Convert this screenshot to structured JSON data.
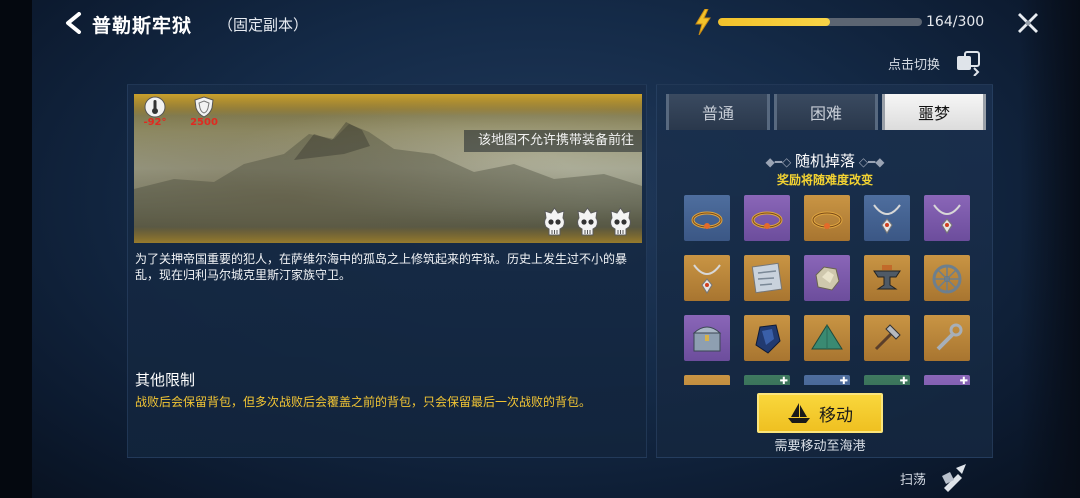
{
  "header": {
    "title": "普勒斯牢狱",
    "subtitle": "（固定副本）",
    "energy": {
      "current": 164,
      "max": 300,
      "text": "164/300",
      "fill_fraction": 0.547
    }
  },
  "switch": {
    "label": "点击切换"
  },
  "map": {
    "notice": "该地图不允许携带装备前往",
    "stats": [
      {
        "icon": "thermometer-icon",
        "value": "-92°"
      },
      {
        "icon": "shield-icon",
        "value": "2500"
      }
    ],
    "difficulty_skulls": 3
  },
  "description": "为了关押帝国重要的犯人，在萨维尔海中的孤岛之上修筑起来的牢狱。历史上发生过不小的暴乱，现在归利马尔城克里斯汀家族守卫。",
  "limits": {
    "heading": "其他限制",
    "text": "战败后会保留背包，但多次战败后会覆盖之前的背包，只会保留最后一次战败的背包。"
  },
  "tabs": [
    {
      "label": "普通",
      "active": false
    },
    {
      "label": "困难",
      "active": false
    },
    {
      "label": "噩梦",
      "active": true
    }
  ],
  "drops": {
    "title": "随机掉落",
    "note": "奖励将随难度改变",
    "items": [
      {
        "icon": "bracelet-icon",
        "rarity": "blue"
      },
      {
        "icon": "bracelet-icon",
        "rarity": "purple"
      },
      {
        "icon": "bracelet-icon",
        "rarity": "orange"
      },
      {
        "icon": "necklace-icon",
        "rarity": "blue"
      },
      {
        "icon": "necklace-icon",
        "rarity": "purple"
      },
      {
        "icon": "necklace-icon",
        "rarity": "orange"
      },
      {
        "icon": "map-scroll-icon",
        "rarity": "orange"
      },
      {
        "icon": "ore-icon",
        "rarity": "purple"
      },
      {
        "icon": "anvil-icon",
        "rarity": "orange"
      },
      {
        "icon": "wheel-icon",
        "rarity": "orange"
      },
      {
        "icon": "chest-icon",
        "rarity": "purple"
      },
      {
        "icon": "crystal-icon",
        "rarity": "orange"
      },
      {
        "icon": "tent-icon",
        "rarity": "orange"
      },
      {
        "icon": "hammer-icon",
        "rarity": "orange"
      },
      {
        "icon": "wrench-icon",
        "rarity": "orange"
      },
      {
        "icon": "item-icon",
        "rarity": "orange"
      },
      {
        "icon": "item-icon",
        "rarity": "green"
      },
      {
        "icon": "item-icon",
        "rarity": "blue"
      },
      {
        "icon": "item-icon",
        "rarity": "green"
      },
      {
        "icon": "item-icon",
        "rarity": "purple"
      }
    ]
  },
  "move": {
    "label": "移动",
    "hint": "需要移动至海港"
  },
  "sweep": {
    "label": "扫荡"
  },
  "colors": {
    "accent_yellow": "#f2c534",
    "stat_red": "#e02a21",
    "energy_fill": "#f3c22b"
  }
}
